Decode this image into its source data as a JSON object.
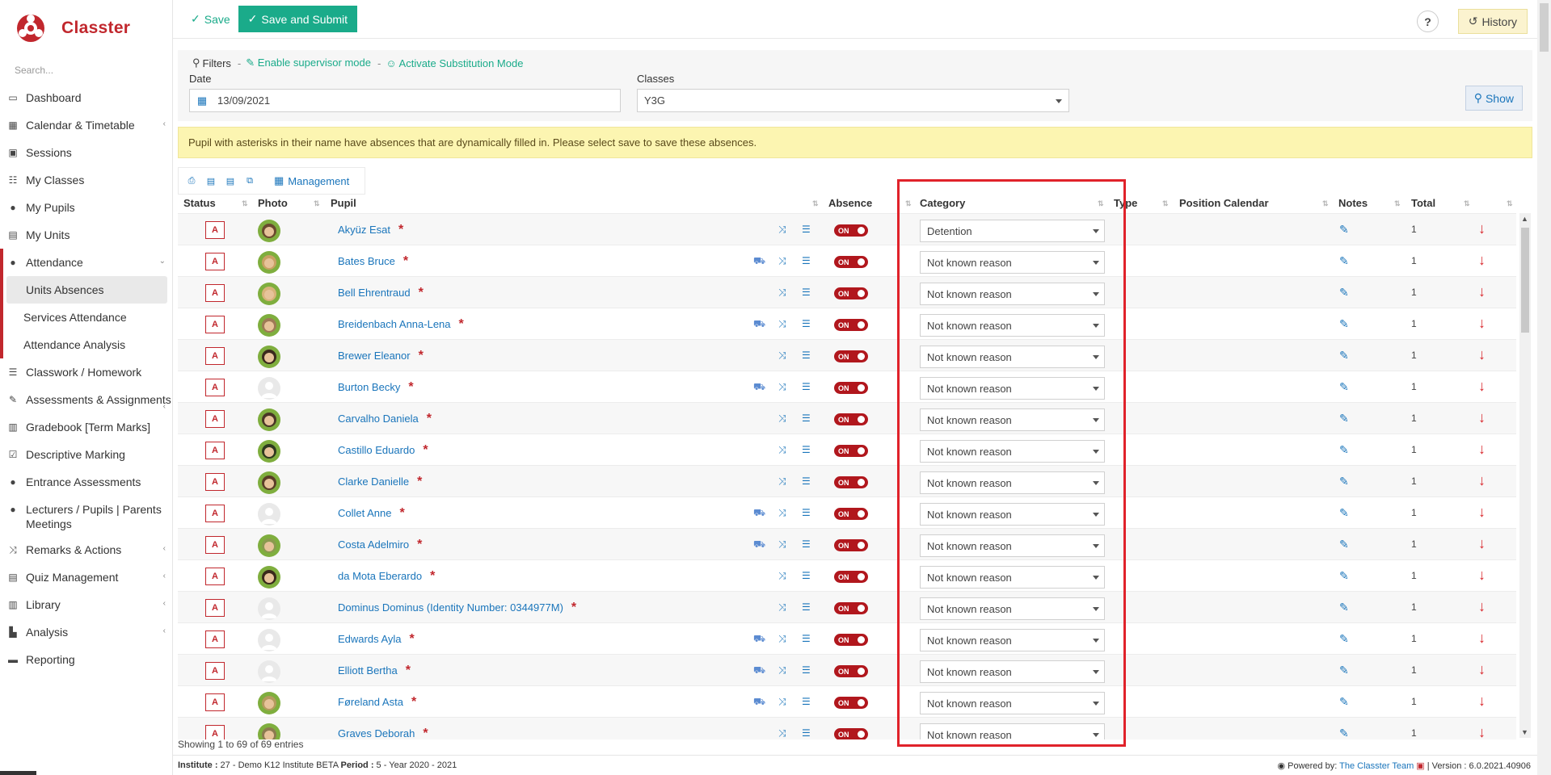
{
  "app": {
    "name": "Classter",
    "search_placeholder": "Search..."
  },
  "sidebar": {
    "items": [
      {
        "label": "Dashboard",
        "icon": "laptop-icon"
      },
      {
        "label": "Calendar & Timetable",
        "icon": "calendar-icon"
      },
      {
        "label": "Sessions",
        "icon": "sessions-icon"
      },
      {
        "label": "My Classes",
        "icon": "classes-icon"
      },
      {
        "label": "My Pupils",
        "icon": "pupils-icon"
      },
      {
        "label": "My Units",
        "icon": "book-icon"
      },
      {
        "label": "Attendance",
        "icon": "attendance-icon"
      },
      {
        "label": "Units Absences"
      },
      {
        "label": "Services Attendance"
      },
      {
        "label": "Attendance Analysis"
      },
      {
        "label": "Classwork / Homework",
        "icon": "list-icon"
      },
      {
        "label": "Assessments & Assignments",
        "icon": "edit-icon"
      },
      {
        "label": "Gradebook [Term Marks]",
        "icon": "gradebook-icon"
      },
      {
        "label": "Descriptive Marking",
        "icon": "check-icon"
      },
      {
        "label": "Entrance Assessments",
        "icon": "user-icon"
      },
      {
        "label": "Lecturers / Pupils | Parents Meetings",
        "icon": "meetings-icon"
      },
      {
        "label": "Remarks & Actions",
        "icon": "shuffle-icon"
      },
      {
        "label": "Quiz Management",
        "icon": "quiz-icon"
      },
      {
        "label": "Library",
        "icon": "library-icon"
      },
      {
        "label": "Analysis",
        "icon": "chart-icon"
      },
      {
        "label": "Reporting",
        "icon": "print-icon"
      }
    ]
  },
  "topbar": {
    "save": "Save",
    "save_submit": "Save and Submit",
    "help": "?",
    "history": "History"
  },
  "filters": {
    "label": "Filters",
    "supervisor": "Enable supervisor mode",
    "substitution": "Activate Substitution Mode",
    "date_label": "Date",
    "date_value": "13/09/2021",
    "classes_label": "Classes",
    "classes_value": "Y3G",
    "show": "Show"
  },
  "banner": "Pupil with asterisks in their name have absences that are dynamically filled in. Please select save to save these absences.",
  "toolbar": {
    "management": "Management"
  },
  "table": {
    "headers": {
      "status": "Status",
      "photo": "Photo",
      "pupil": "Pupil",
      "absence": "Absence",
      "category": "Category",
      "type": "Type",
      "position_calendar": "Position Calendar",
      "notes": "Notes",
      "total": "Total"
    },
    "toggle_label": "ON",
    "rows": [
      {
        "status": "A",
        "name": "Akyüz Esat",
        "category": "Detention",
        "total": "1",
        "bus": false,
        "photo": "#6a4a2e"
      },
      {
        "status": "A",
        "name": "Bates Bruce",
        "category": "Not known reason",
        "total": "1",
        "bus": true,
        "photo": "#c9a064"
      },
      {
        "status": "A",
        "name": "Bell Ehrentraud",
        "category": "Not known reason",
        "total": "1",
        "bus": false,
        "photo": "#d8b27a"
      },
      {
        "status": "A",
        "name": "Breidenbach Anna-Lena",
        "category": "Not known reason",
        "total": "1",
        "bus": true,
        "photo": "#9e7a56"
      },
      {
        "status": "A",
        "name": "Brewer Eleanor",
        "category": "Not known reason",
        "total": "1",
        "bus": false,
        "photo": "#3b2a1e"
      },
      {
        "status": "A",
        "name": "Burton Becky",
        "category": "Not known reason",
        "total": "1",
        "bus": true,
        "photo": "none"
      },
      {
        "status": "A",
        "name": "Carvalho Daniela",
        "category": "Not known reason",
        "total": "1",
        "bus": false,
        "photo": "#4a3626"
      },
      {
        "status": "A",
        "name": "Castillo Eduardo",
        "category": "Not known reason",
        "total": "1",
        "bus": false,
        "photo": "#2e3a1f"
      },
      {
        "status": "A",
        "name": "Clarke Danielle",
        "category": "Not known reason",
        "total": "1",
        "bus": false,
        "photo": "#5a3d28"
      },
      {
        "status": "A",
        "name": "Collet Anne",
        "category": "Not known reason",
        "total": "1",
        "bus": true,
        "photo": "none"
      },
      {
        "status": "A",
        "name": "Costa Adelmiro",
        "category": "Not known reason",
        "total": "1",
        "bus": true,
        "photo": "#8a9a4e"
      },
      {
        "status": "A",
        "name": "da Mota Eberardo",
        "category": "Not known reason",
        "total": "1",
        "bus": false,
        "photo": "#3a2a1c"
      },
      {
        "status": "A",
        "name": "Dominus Dominus (Identity Number: 0344977M)",
        "category": "Not known reason",
        "total": "1",
        "bus": false,
        "photo": "none"
      },
      {
        "status": "A",
        "name": "Edwards Ayla",
        "category": "Not known reason",
        "total": "1",
        "bus": true,
        "photo": "none"
      },
      {
        "status": "A",
        "name": "Elliott Bertha",
        "category": "Not known reason",
        "total": "1",
        "bus": true,
        "photo": "none"
      },
      {
        "status": "A",
        "name": "Føreland Asta",
        "category": "Not known reason",
        "total": "1",
        "bus": true,
        "photo": "#b59a5e"
      },
      {
        "status": "A",
        "name": "Graves Deborah",
        "category": "Not known reason",
        "total": "1",
        "bus": false,
        "photo": "#8c7a50"
      }
    ]
  },
  "entries_info": "Showing 1 to 69 of 69 entries",
  "footer": {
    "institute_label": "Institute :",
    "institute_value": " 27 - Demo K12 Institute BETA ",
    "period_label": "Period :",
    "period_value": " 5 - Year 2020 - 2021",
    "powered_prefix": "Powered by: ",
    "team": "The Classter Team",
    "version": " | Version : 6.0.2021.40906"
  },
  "colors": {
    "accent": "#1aab8a",
    "brand": "#c1272d",
    "link": "#1a75bb",
    "highlight": "#e0222a"
  }
}
